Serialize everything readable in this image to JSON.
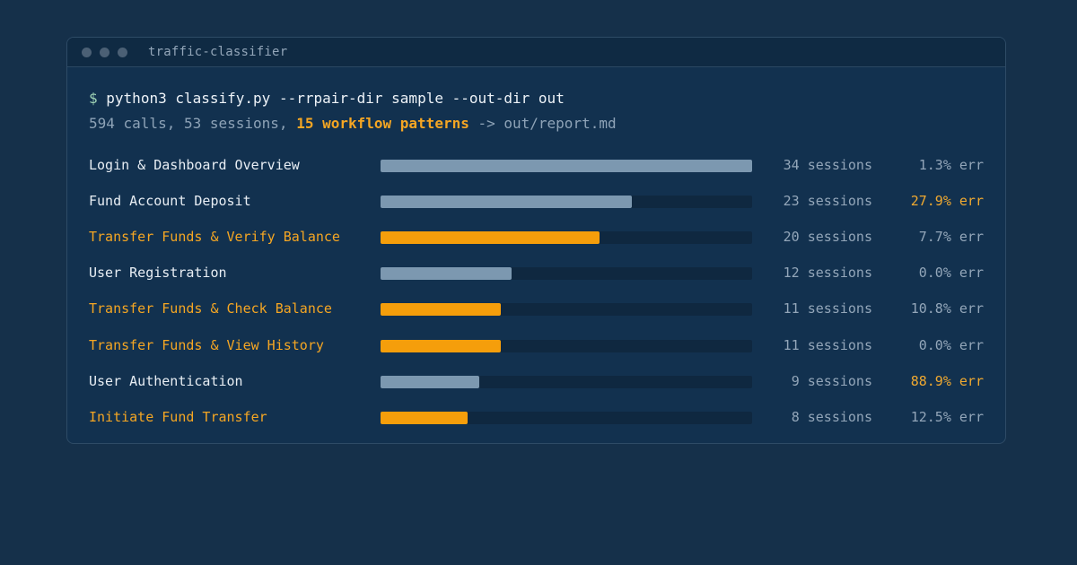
{
  "window": {
    "title": "traffic-classifier"
  },
  "terminal": {
    "prompt": "$",
    "command": "python3 classify.py --rrpair-dir sample --out-dir out",
    "summary_prefix": "594 calls, 53 sessions, ",
    "summary_highlight": "15 workflow patterns",
    "summary_suffix": " -> out/report.md"
  },
  "colors": {
    "accent": "#f59e0b",
    "bar_default": "#7c98b0",
    "background": "#15304a"
  },
  "workflows": [
    {
      "name": "Login & Dashboard Overview",
      "sessions": 34,
      "sessions_label": "34 sessions",
      "err": "1.3% err",
      "accent": false,
      "high_err": false
    },
    {
      "name": "Fund Account Deposit",
      "sessions": 23,
      "sessions_label": "23 sessions",
      "err": "27.9% err",
      "accent": false,
      "high_err": true
    },
    {
      "name": "Transfer Funds & Verify Balance",
      "sessions": 20,
      "sessions_label": "20 sessions",
      "err": "7.7% err",
      "accent": true,
      "high_err": false
    },
    {
      "name": "User Registration",
      "sessions": 12,
      "sessions_label": "12 sessions",
      "err": "0.0% err",
      "accent": false,
      "high_err": false
    },
    {
      "name": "Transfer Funds & Check Balance",
      "sessions": 11,
      "sessions_label": "11 sessions",
      "err": "10.8% err",
      "accent": true,
      "high_err": false
    },
    {
      "name": "Transfer Funds & View History",
      "sessions": 11,
      "sessions_label": "11 sessions",
      "err": "0.0% err",
      "accent": true,
      "high_err": false
    },
    {
      "name": "User Authentication",
      "sessions": 9,
      "sessions_label": "9 sessions",
      "err": "88.9% err",
      "accent": false,
      "high_err": true
    },
    {
      "name": "Initiate Fund Transfer",
      "sessions": 8,
      "sessions_label": "8 sessions",
      "err": "12.5% err",
      "accent": true,
      "high_err": false
    }
  ]
}
